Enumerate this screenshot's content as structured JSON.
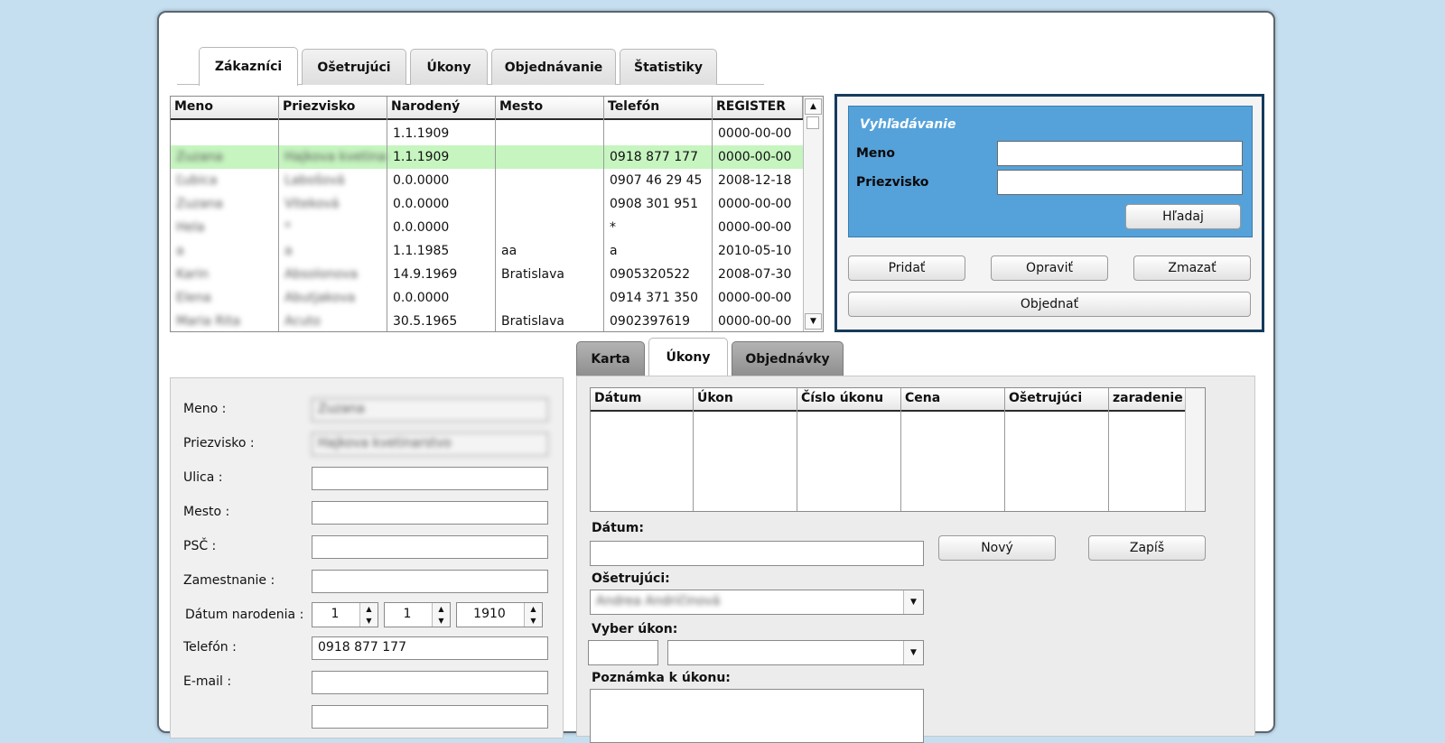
{
  "main_tabs": [
    {
      "label": "Zákazníci",
      "active": true
    },
    {
      "label": "Ošetrujúci",
      "active": false
    },
    {
      "label": "Úkony",
      "active": false
    },
    {
      "label": "Objednávanie",
      "active": false
    },
    {
      "label": "Štatistiky",
      "active": false
    }
  ],
  "customers": {
    "columns": [
      "Meno",
      "Priezvisko",
      "Narodený",
      "Mesto",
      "Telefón",
      "REGISTER"
    ],
    "rows": [
      [
        "",
        "",
        "1.1.1909",
        "",
        "",
        "0000-00-00"
      ],
      [
        "Zuzana",
        "Hajkova kvetinarstvo",
        "1.1.1909",
        "",
        "0918 877 177",
        "0000-00-00"
      ],
      [
        "Ľubica",
        "Labošová",
        "0.0.0000",
        "",
        "0907 46 29 45",
        "2008-12-18"
      ],
      [
        "Zuzana",
        "Viteková",
        "0.0.0000",
        "",
        "0908 301 951",
        "0000-00-00"
      ],
      [
        "Hela",
        "*",
        "0.0.0000",
        "",
        "*",
        "0000-00-00"
      ],
      [
        "a",
        "a",
        "1.1.1985",
        "aa",
        "a",
        "2010-05-10"
      ],
      [
        "Karin",
        "Absolonova",
        "14.9.1969",
        "Bratislava",
        "0905320522",
        "2008-07-30"
      ],
      [
        "Elena",
        "Abutjakova",
        "0.0.0000",
        "",
        "0914 371 350",
        "0000-00-00"
      ],
      [
        "Maria Rita",
        "Acuto",
        "30.5.1965",
        "Bratislava",
        "0902397619",
        "0000-00-00"
      ]
    ],
    "selected_row": 1
  },
  "search": {
    "title": "Vyhľadávanie",
    "name_label": "Meno",
    "surname_label": "Priezvisko",
    "name_value": "",
    "surname_value": "",
    "search_button": "Hľadaj"
  },
  "actions": {
    "add": "Pridať",
    "edit": "Opraviť",
    "delete": "Zmazať",
    "order": "Objednať"
  },
  "form": {
    "meno_label": "Meno :",
    "meno_value": "Zuzana",
    "priezvisko_label": "Priezvisko :",
    "priezvisko_value": "Hajkova kvetinarstvo",
    "ulica_label": "Ulica :",
    "ulica_value": "",
    "mesto_label": "Mesto :",
    "mesto_value": "",
    "psc_label": "PSČ :",
    "psc_value": "",
    "zamestnanie_label": "Zamestnanie :",
    "zamestnanie_value": "",
    "datum_label": "Dátum narodenia :",
    "datum_day": "1",
    "datum_month": "1",
    "datum_year": "1910",
    "telefon_label": "Telefón :",
    "telefon_value": "0918 877 177",
    "email_label": "E-mail :",
    "email_value": ""
  },
  "sub_tabs": [
    {
      "label": "Karta",
      "active": false
    },
    {
      "label": "Úkony",
      "active": true
    },
    {
      "label": "Objednávky",
      "active": false
    }
  ],
  "acts_table": {
    "columns": [
      "Dátum",
      "Úkon",
      "Číslo úkonu",
      "Cena",
      "Ošetrujúci",
      "zaradenie"
    ]
  },
  "act_form": {
    "datum_label": "Dátum:",
    "datum_value": "",
    "new_button": "Nový",
    "write_button": "Zapíš",
    "osetrujuci_label": "Ošetrujúci:",
    "osetrujuci_value": "Andrea Andričinová",
    "vyber_label": "Vyber úkon:",
    "vyber_code": "",
    "vyber_value": "",
    "poznamka_label": "Poznámka k úkonu:"
  }
}
